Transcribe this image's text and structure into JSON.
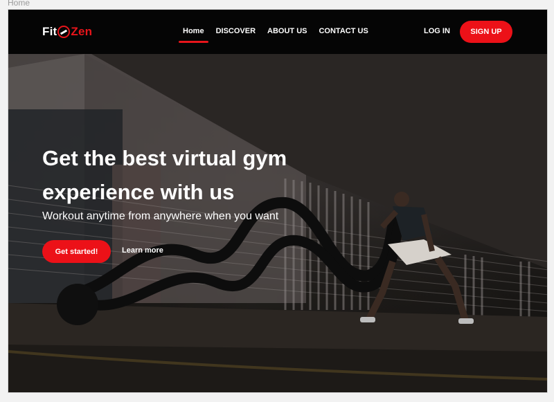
{
  "page": {
    "tab_label": "Home"
  },
  "brand": {
    "part1": "Fit",
    "part2": "Zen",
    "accent": "#e8151b"
  },
  "nav": {
    "links": [
      {
        "label": "Home",
        "active": true
      },
      {
        "label": "DISCOVER",
        "active": false
      },
      {
        "label": "ABOUT US",
        "active": false
      },
      {
        "label": "CONTACT US",
        "active": false
      }
    ],
    "login_label": "LOG IN",
    "signup_label": "SIGN UP"
  },
  "hero": {
    "title": "Get the best virtual gym experience  with us",
    "subtitle": "Workout anytime from anywhere when you want",
    "primary_cta": "Get started!",
    "secondary_cta": "Learn more"
  },
  "colors": {
    "primary": "#ec1118",
    "navbar": "#050505",
    "text": "#ffffff"
  }
}
